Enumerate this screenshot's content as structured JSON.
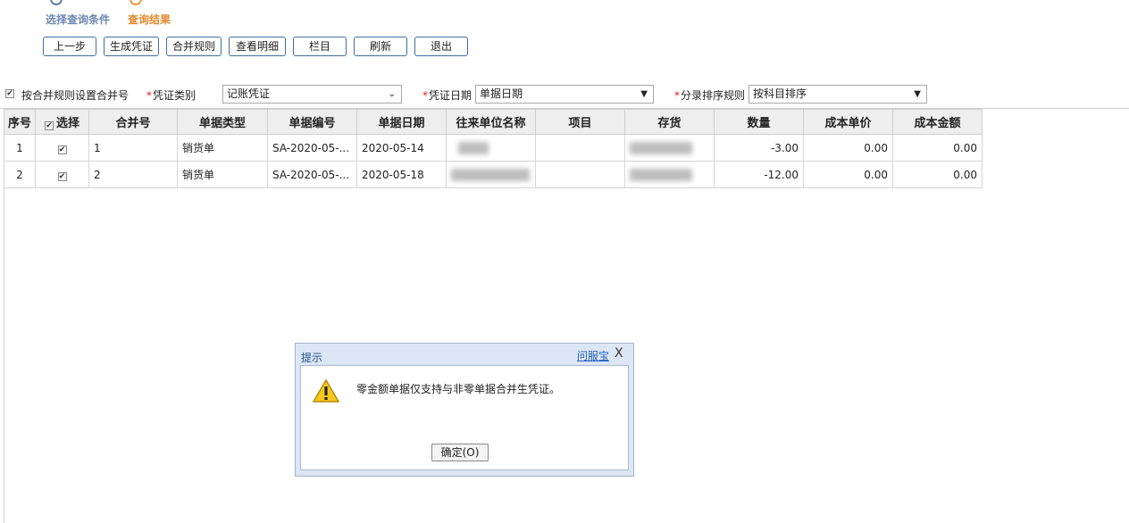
{
  "steps": {
    "step1_label": "选择查询条件",
    "step2_label": "查询结果"
  },
  "toolbar": {
    "prev_label": "上一步",
    "gen_voucher_label": "生成凭证",
    "merge_rule_label": "合并规则",
    "view_detail_label": "查看明细",
    "columns_label": "栏目",
    "refresh_label": "刷新",
    "exit_label": "退出"
  },
  "filters": {
    "merge_checkbox_label": "按合并规则设置合并号",
    "voucher_type_label": "凭证类别",
    "voucher_type_value": "记账凭证",
    "voucher_date_label": "凭证日期",
    "voucher_date_value": "单据日期",
    "sort_rule_label": "分录排序规则",
    "sort_rule_value": "按科目排序"
  },
  "grid": {
    "headers": {
      "seq": "序号",
      "select": "选择",
      "merge_no": "合并号",
      "doc_type": "单据类型",
      "doc_no": "单据编号",
      "doc_date": "单据日期",
      "partner": "往来单位名称",
      "project": "项目",
      "inventory": "存货",
      "qty": "数量",
      "unit_cost": "成本单价",
      "cost_amount": "成本金额"
    },
    "rows": [
      {
        "seq": "1",
        "merge_no": "1",
        "doc_type": "销货单",
        "doc_no": "SA-2020-05-...",
        "doc_date": "2020-05-14",
        "project": "",
        "qty": "-3.00",
        "unit_cost": "0.00",
        "cost_amount": "0.00"
      },
      {
        "seq": "2",
        "merge_no": "2",
        "doc_type": "销货单",
        "doc_no": "SA-2020-05-...",
        "doc_date": "2020-05-18",
        "project": "",
        "qty": "-12.00",
        "unit_cost": "0.00",
        "cost_amount": "0.00"
      }
    ]
  },
  "dialog": {
    "title": "提示",
    "help_link": "问服宝",
    "close_glyph": "X",
    "message": "零金额单据仅支持与非零单据合并生凭证。",
    "ok_label": "确定(O)"
  },
  "colors": {
    "accent_blue": "#3f6ea3",
    "step_active": "#e08a2a",
    "negative": "#e02020"
  }
}
